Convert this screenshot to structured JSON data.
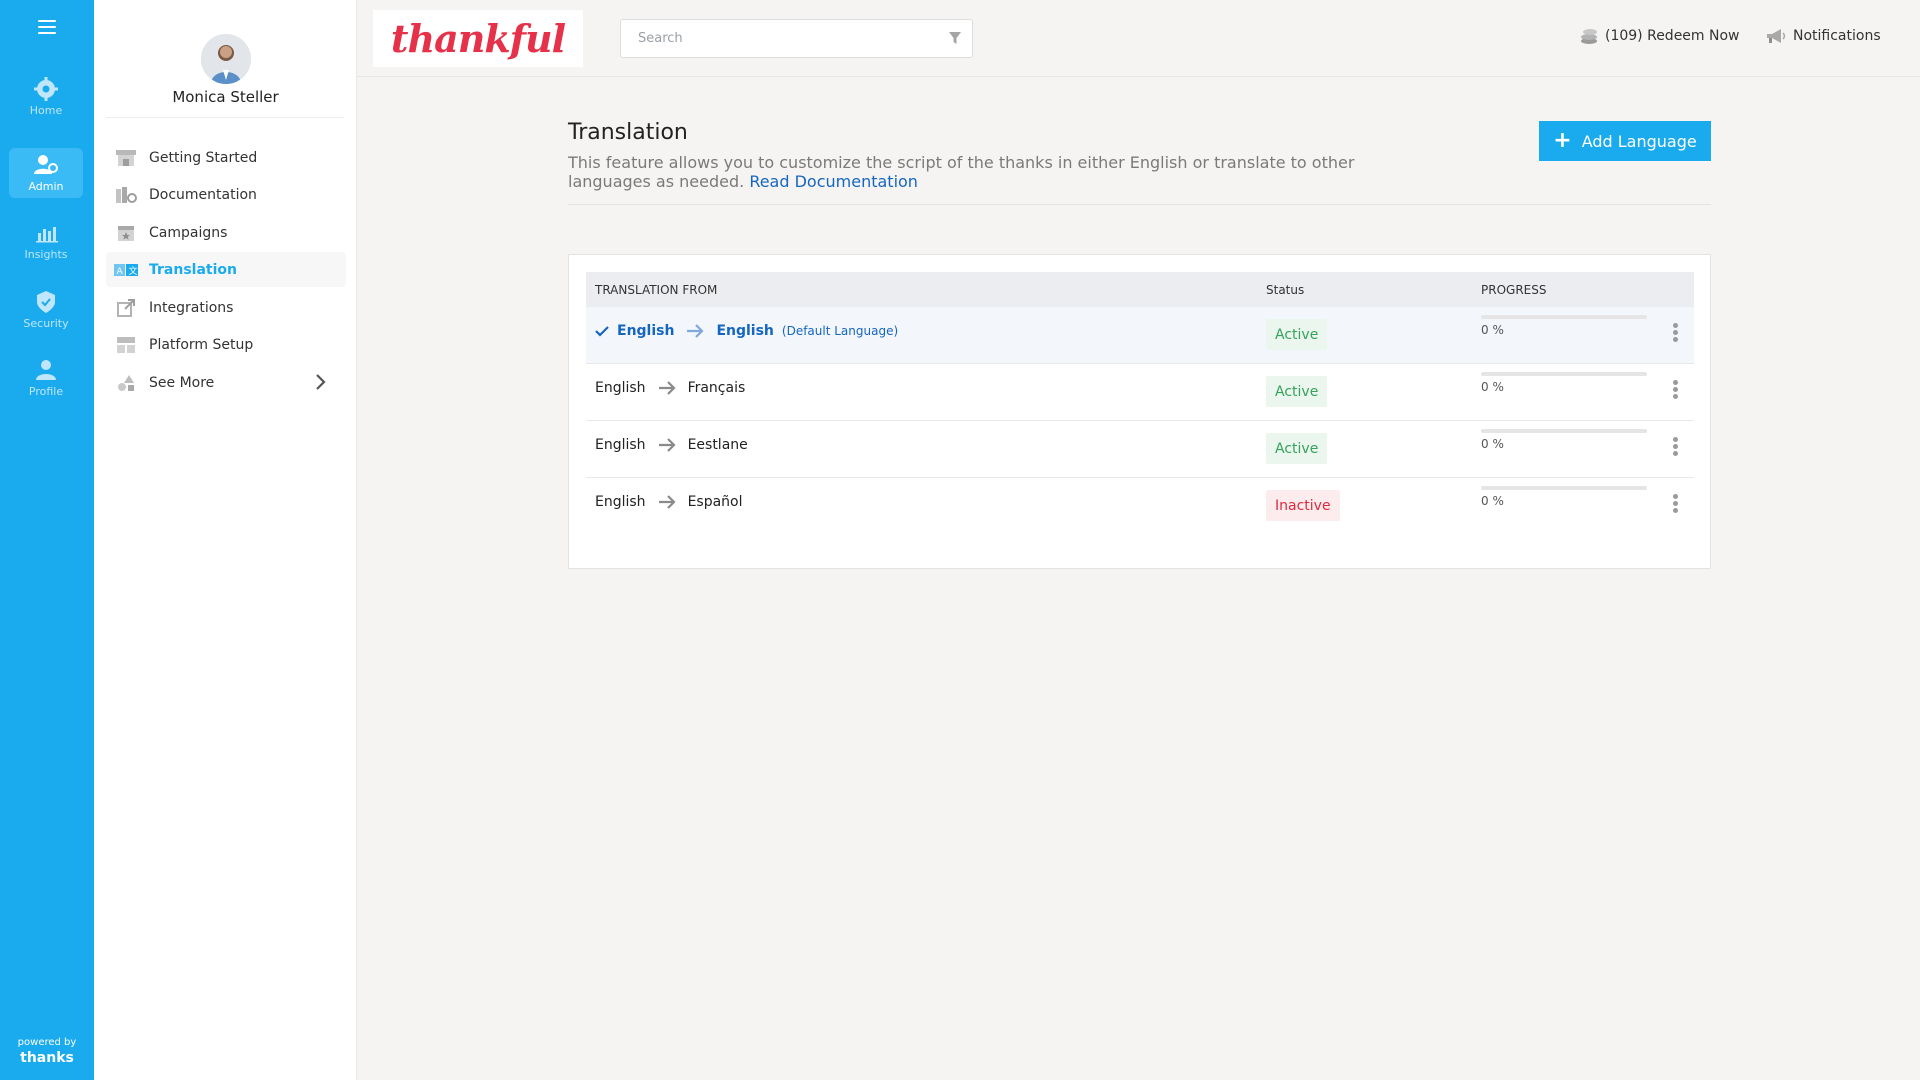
{
  "rail": {
    "items": [
      {
        "label": "Home",
        "icon": "gear-icon"
      },
      {
        "label": "Admin",
        "icon": "admin-user-icon"
      },
      {
        "label": "Insights",
        "icon": "bar-chart-icon"
      },
      {
        "label": "Security",
        "icon": "shield-icon"
      },
      {
        "label": "Profile",
        "icon": "profile-icon"
      }
    ],
    "powered_by": "powered by",
    "powered_brand": "thanks",
    "accent": "#1aabef"
  },
  "user": {
    "name": "Monica Steller"
  },
  "subnav": {
    "items": [
      {
        "label": "Getting Started",
        "icon": "storefront-icon"
      },
      {
        "label": "Documentation",
        "icon": "documentation-icon"
      },
      {
        "label": "Campaigns",
        "icon": "calendar-star-icon"
      },
      {
        "label": "Translation",
        "icon": "translate-icon",
        "active": true
      },
      {
        "label": "Integrations",
        "icon": "external-link-icon"
      },
      {
        "label": "Platform Setup",
        "icon": "layout-icon"
      },
      {
        "label": "See More",
        "icon": "shapes-icon"
      }
    ]
  },
  "topbar": {
    "logo_text": "thankful",
    "search_placeholder": "Search",
    "redeem_label": "(109) Redeem Now",
    "notifications_label": "Notifications"
  },
  "page": {
    "title": "Translation",
    "description": "This feature allows you to customize the script of the thanks in either English or translate to other languages as needed.",
    "doc_link": "Read Documentation",
    "add_button": "Add Language"
  },
  "table": {
    "headers": {
      "from": "TRANSLATION FROM",
      "status": "Status",
      "progress": "PROGRESS"
    },
    "rows": [
      {
        "from": "English",
        "to": "English",
        "note": "(Default Language)",
        "status": "Active",
        "progress": "0 %",
        "progress_value": 0
      },
      {
        "from": "English",
        "to": "Français",
        "note": "",
        "status": "Active",
        "progress": "0 %",
        "progress_value": 0
      },
      {
        "from": "English",
        "to": "Eestlane",
        "note": "",
        "status": "Active",
        "progress": "0 %",
        "progress_value": 0
      },
      {
        "from": "English",
        "to": "Español",
        "note": "",
        "status": "Inactive",
        "progress": "0 %",
        "progress_value": 0
      }
    ]
  }
}
